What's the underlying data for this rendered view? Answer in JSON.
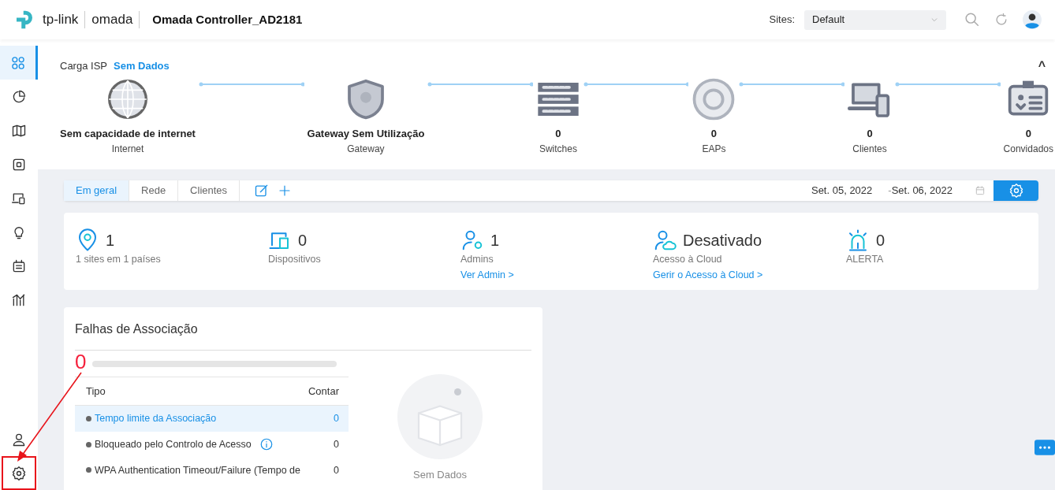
{
  "header": {
    "brand": "tp-link",
    "product": "omada",
    "title": "Omada Controller_AD2181",
    "sites_label": "Sites:",
    "site": "Default"
  },
  "sidebar": {
    "items": [
      {
        "kind": "dashboard",
        "selected": true
      },
      {
        "kind": "statistics",
        "selected": false
      },
      {
        "kind": "map",
        "selected": false
      },
      {
        "kind": "devices",
        "selected": false
      },
      {
        "kind": "clients",
        "selected": false
      },
      {
        "kind": "insight",
        "selected": false
      },
      {
        "kind": "logs",
        "selected": false
      },
      {
        "kind": "reports",
        "selected": false
      }
    ],
    "bottom": [
      {
        "kind": "account",
        "selected": false,
        "highlighted": false
      },
      {
        "kind": "settings",
        "selected": false,
        "highlighted": true
      }
    ]
  },
  "topology": {
    "isp_label": "Carga ISP",
    "isp_value": "Sem Dados",
    "collapse": "^",
    "nodes": [
      {
        "kind": "internet",
        "value": "Sem capacidade de internet",
        "label": "Internet"
      },
      {
        "kind": "gateway",
        "value": "Gateway Sem Utilização",
        "label": "Gateway"
      },
      {
        "kind": "switch",
        "value": "0",
        "label": "Switches"
      },
      {
        "kind": "eap",
        "value": "0",
        "label": "EAPs"
      },
      {
        "kind": "client",
        "value": "0",
        "label": "Clientes"
      },
      {
        "kind": "guest",
        "value": "0",
        "label": "Convidados"
      }
    ]
  },
  "tabs": [
    {
      "label": "Em geral",
      "selected": true
    },
    {
      "label": "Rede",
      "selected": false
    },
    {
      "label": "Clientes",
      "selected": false
    }
  ],
  "date_range": {
    "from": "Set. 05, 2022",
    "separator": "-",
    "to": "Set. 06, 2022"
  },
  "stats": [
    {
      "kind": "sites",
      "value": "1",
      "label": "1 sites em  1 países"
    },
    {
      "kind": "devices",
      "value": "0",
      "label": "Dispositivos"
    },
    {
      "kind": "admins",
      "value": "1",
      "label": "Admins",
      "link": "Ver Admin >"
    },
    {
      "kind": "cloud",
      "value": "Desativado",
      "label": "Acesso à Cloud",
      "link": "Gerir o Acesso à Cloud >"
    },
    {
      "kind": "alert",
      "value": "0",
      "label": "ALERTA"
    }
  ],
  "association_failures": {
    "title": "Falhas de Associação",
    "total": "0",
    "columns": [
      "Tipo",
      "Contar"
    ],
    "rows": [
      {
        "type": "Tempo limite da Associação",
        "count": "0",
        "selected": true,
        "info": false
      },
      {
        "type": "Bloqueado pelo Controlo de Acesso",
        "count": "0",
        "selected": false,
        "info": true
      },
      {
        "type": "WPA Authentication Timeout/Failure (Tempo de",
        "count": "0",
        "selected": false,
        "info": false
      }
    ],
    "empty_text": "Sem Dados"
  },
  "annotation": {
    "arrow": true
  }
}
